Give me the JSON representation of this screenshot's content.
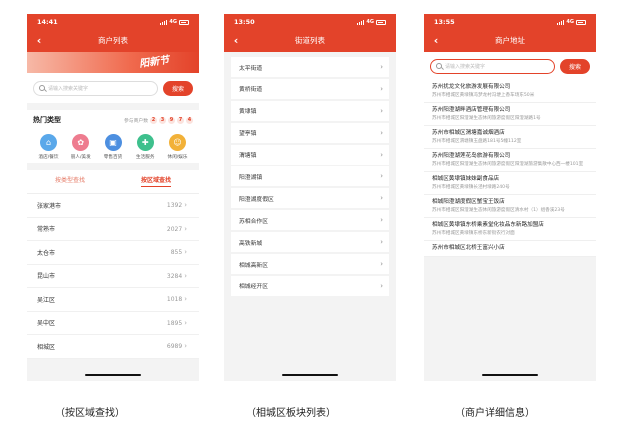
{
  "colors": {
    "brand": "#e3432a"
  },
  "status_bar": {
    "p1_time": "14:41",
    "p2_time": "13:50",
    "p3_time": "13:55",
    "network": "4G"
  },
  "screen1": {
    "title": "商户列表",
    "banner_text": "阳新节",
    "search": {
      "placeholder": "请输入搜索关键字",
      "button": "搜索"
    },
    "hot": {
      "title": "热门类型",
      "participants_label": "参与商户数",
      "digits": [
        "2",
        "3",
        "9",
        "7",
        "4"
      ]
    },
    "categories": [
      {
        "label": "酒店/餐饮",
        "icon": "hotel-icon",
        "color": "#5aa8ea"
      },
      {
        "label": "丽人/美发",
        "icon": "beauty-icon",
        "color": "#ee7c8f"
      },
      {
        "label": "零售百货",
        "icon": "retail-icon",
        "color": "#4d8fe0"
      },
      {
        "label": "生活服务",
        "icon": "service-icon",
        "color": "#3ec08d"
      },
      {
        "label": "休闲/娱乐",
        "icon": "leisure-icon",
        "color": "#f2b138"
      }
    ],
    "tabs": [
      "按类型查找",
      "按区域查找"
    ],
    "regions": [
      {
        "name": "张家港市",
        "count": "1392"
      },
      {
        "name": "常熟市",
        "count": "2027"
      },
      {
        "name": "太仓市",
        "count": "855"
      },
      {
        "name": "昆山市",
        "count": "3284"
      },
      {
        "name": "吴江区",
        "count": "1018"
      },
      {
        "name": "吴中区",
        "count": "1895"
      },
      {
        "name": "相城区",
        "count": "6989"
      }
    ]
  },
  "screen2": {
    "title": "街道列表",
    "streets": [
      "太平街道",
      "黄桥街道",
      "黄埭镇",
      "望亭镇",
      "渭塘镇",
      "阳澄湖镇",
      "阳澄湖度假区",
      "苏相合作区",
      "高铁新城",
      "相城高新区",
      "相城经开区"
    ]
  },
  "screen3": {
    "title": "商户地址",
    "search": {
      "placeholder": "请输入搜索关键字",
      "button": "搜索"
    },
    "merchants": [
      {
        "name": "苏州扰龙文化旅游发展有限公司",
        "address": "苏州市相城区黄埭镇冯梦龙村冯埂上香车场东50米"
      },
      {
        "name": "苏州阳澄湖畔酒店管理有限公司",
        "address": "苏州市相城区阳澄湖生态休闲旅游度假区阳澄湖路1号"
      },
      {
        "name": "苏州市相城区渭塘嘉诚烟酒店",
        "address": "苏州市相城区渭塘镇玉盘路181号5幢112室"
      },
      {
        "name": "苏州阳澄湖莲花岛旅游有限公司",
        "address": "苏州市相城区阳澄湖生态休闲旅游度假区阳澄湖旅游集散中心西一楼101室"
      },
      {
        "name": "相城区黄埭镇妹妹副食品店",
        "address": "苏州市相城区黄埭镇长泾村埭路240号"
      },
      {
        "name": "相城阳澄湖度假区蟹宝王饭店",
        "address": "苏州市相城区阳澄湖生态休闲旅游度假区清水村（1）组香溪23号"
      },
      {
        "name": "相城区黄埭镇东桥乘素堂化妆品东新路加盟店",
        "address": "苏州市相城区黄埭镇东桥东新街农行对面"
      },
      {
        "name": "苏州市相城区北桥王富兴小店",
        "address": ""
      }
    ]
  },
  "captions": [
    "（按区域查找）",
    "（相城区板块列表）",
    "（商户详细信息）"
  ]
}
